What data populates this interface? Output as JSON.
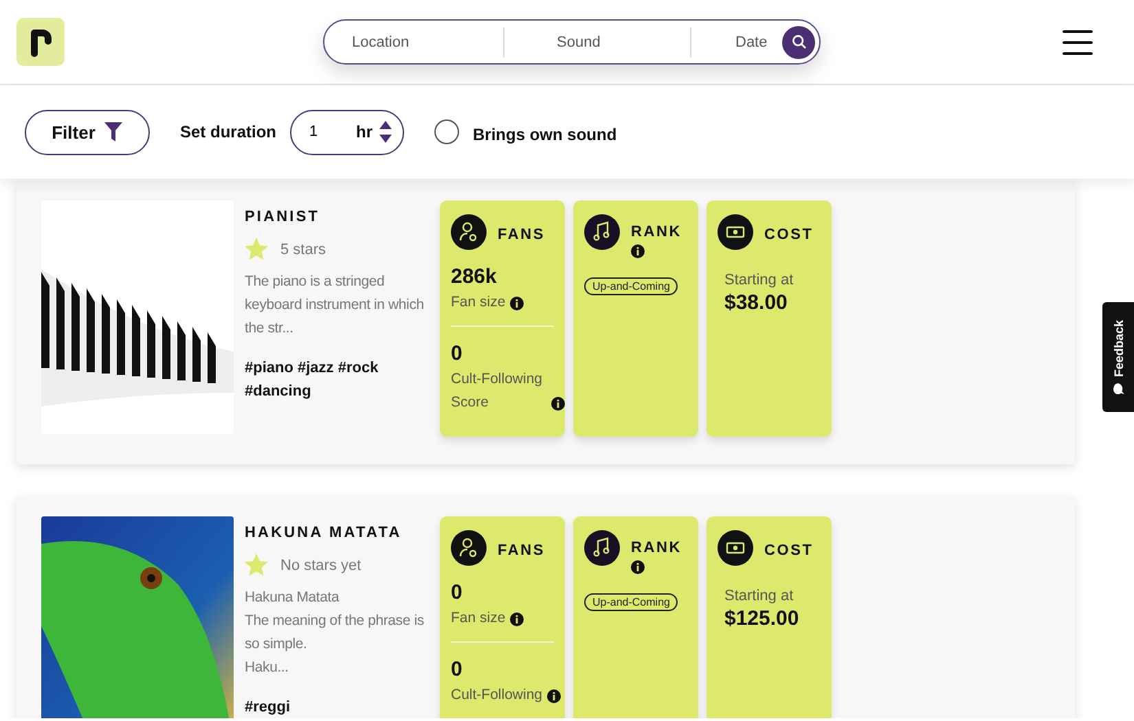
{
  "header": {
    "search_fields": [
      {
        "placeholder": "Location"
      },
      {
        "placeholder": "Sound"
      },
      {
        "placeholder": "Date"
      }
    ]
  },
  "filters": {
    "filter_button": "Filter",
    "duration_label": "Set duration",
    "duration": {
      "value": "1",
      "unit": "hr"
    },
    "own_sound": {
      "label": "Brings own sound",
      "checked": false
    }
  },
  "listings": [
    {
      "kind": "piano",
      "title": "PIANIST",
      "rating": "5 stars",
      "description": "The piano is a stringed keyboard instrument in which the str...",
      "tags": "#piano #jazz #rock #dancing",
      "fans": {
        "heading": "FANS",
        "fan_size": "286k",
        "fan_size_label": "Fan size",
        "cult_score": "0",
        "cult_label": "Cult-Following Score"
      },
      "rank": {
        "heading": "RANK",
        "badge": "Up-and-Coming"
      },
      "cost": {
        "heading": "COST",
        "prefix": "Starting at",
        "price": "$38.00"
      }
    },
    {
      "kind": "lizard",
      "title": "HAKUNA MATATA",
      "rating": "No stars yet",
      "description": "Hakuna Matata\nThe meaning of the phrase is so simple.\nHaku...",
      "tags": "#reggi",
      "fans": {
        "heading": "FANS",
        "fan_size": "0",
        "fan_size_label": "Fan size",
        "cult_score": "0",
        "cult_label": "Cult-Following"
      },
      "rank": {
        "heading": "RANK",
        "badge": "Up-and-Coming"
      },
      "cost": {
        "heading": "COST",
        "prefix": "Starting at",
        "price": "$125.00"
      }
    }
  ],
  "feedback": "Feedback"
}
